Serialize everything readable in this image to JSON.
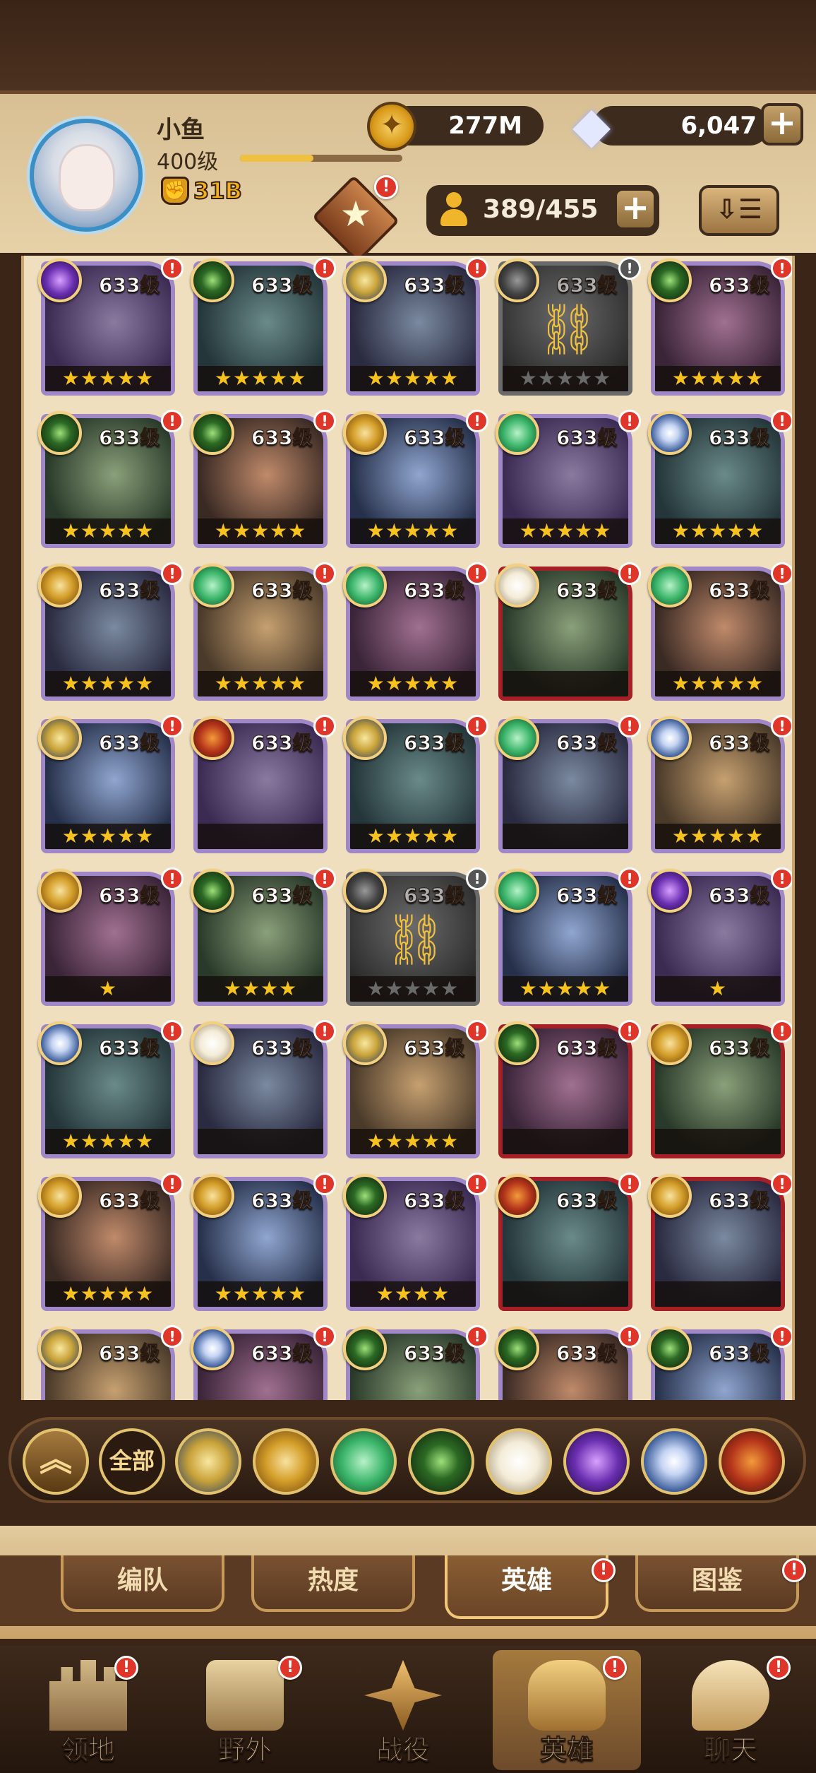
{
  "player": {
    "name": "小鱼",
    "level": "400级",
    "power": "31B",
    "xp_progress": 0.45,
    "avatar_icon": "portrait"
  },
  "currency": {
    "gold": "277M",
    "diamonds": "6,047",
    "gold_icon": "gold-coin-icon",
    "diamond_icon": "diamond-icon"
  },
  "hero_count": "389/455",
  "badge": "!",
  "heroes": [
    {
      "level": "633级",
      "stars": "★★★★★",
      "faction": "hypogean",
      "frame": "purple"
    },
    {
      "level": "633级",
      "stars": "★★★★★",
      "faction": "graveborn",
      "frame": "purple"
    },
    {
      "level": "633级",
      "stars": "★★★★★",
      "faction": "lightbearer",
      "frame": "purple"
    },
    {
      "level": "633级",
      "stars": "★★★★★",
      "faction": "dark",
      "frame": "gray",
      "locked": true
    },
    {
      "level": "633级",
      "stars": "★★★★★",
      "faction": "graveborn",
      "frame": "purple"
    },
    {
      "level": "633级",
      "stars": "★★★★★",
      "faction": "graveborn",
      "frame": "purple"
    },
    {
      "level": "633级",
      "stars": "★★★★★",
      "faction": "graveborn",
      "frame": "purple"
    },
    {
      "level": "633级",
      "stars": "★★★★★",
      "faction": "gear",
      "frame": "purple"
    },
    {
      "level": "633级",
      "stars": "★★★★★",
      "faction": "wilder",
      "frame": "purple"
    },
    {
      "level": "633级",
      "stars": "★★★★★",
      "faction": "dimensional",
      "frame": "purple"
    },
    {
      "level": "633级",
      "stars": "★★★★★",
      "faction": "gear",
      "frame": "purple"
    },
    {
      "level": "633级",
      "stars": "★★★★★",
      "faction": "wilder",
      "frame": "purple"
    },
    {
      "level": "633级",
      "stars": "★★★★★",
      "faction": "wilder",
      "frame": "purple"
    },
    {
      "level": "633级",
      "stars": "",
      "faction": "celestial",
      "frame": "red"
    },
    {
      "level": "633级",
      "stars": "★★★★★",
      "faction": "wilder",
      "frame": "purple"
    },
    {
      "level": "633级",
      "stars": "★★★★★",
      "faction": "lightbearer",
      "frame": "purple"
    },
    {
      "level": "633级",
      "stars": "",
      "faction": "mauler",
      "frame": "purple"
    },
    {
      "level": "633级",
      "stars": "★★★★★",
      "faction": "lightbearer",
      "frame": "purple"
    },
    {
      "level": "633级",
      "stars": "",
      "faction": "wilder",
      "frame": "purple"
    },
    {
      "level": "633级",
      "stars": "★★★★★",
      "faction": "dimensional",
      "frame": "purple"
    },
    {
      "level": "633级",
      "stars": "★",
      "faction": "gear",
      "frame": "purple"
    },
    {
      "level": "633级",
      "stars": "★★★★",
      "faction": "graveborn",
      "frame": "purple"
    },
    {
      "level": "633级",
      "stars": "★★★★★",
      "faction": "dark",
      "frame": "gray",
      "locked": true
    },
    {
      "level": "633级",
      "stars": "★★★★★",
      "faction": "wilder",
      "frame": "purple"
    },
    {
      "level": "633级",
      "stars": "★",
      "faction": "hypogean",
      "frame": "purple"
    },
    {
      "level": "633级",
      "stars": "★★★★★",
      "faction": "dimensional",
      "frame": "purple"
    },
    {
      "level": "633级",
      "stars": "",
      "faction": "celestial",
      "frame": "purple"
    },
    {
      "level": "633级",
      "stars": "★★★★★",
      "faction": "lightbearer",
      "frame": "purple"
    },
    {
      "level": "633级",
      "stars": "",
      "faction": "graveborn",
      "frame": "red"
    },
    {
      "level": "633级",
      "stars": "",
      "faction": "gear",
      "frame": "red"
    },
    {
      "level": "633级",
      "stars": "★★★★★",
      "faction": "gear",
      "frame": "purple"
    },
    {
      "level": "633级",
      "stars": "★★★★★",
      "faction": "gear",
      "frame": "purple"
    },
    {
      "level": "633级",
      "stars": "★★★★",
      "faction": "graveborn",
      "frame": "purple"
    },
    {
      "level": "633级",
      "stars": "",
      "faction": "mauler",
      "frame": "red"
    },
    {
      "level": "633级",
      "stars": "",
      "faction": "gear",
      "frame": "red"
    },
    {
      "level": "633级",
      "stars": "",
      "faction": "lightbearer",
      "frame": "purple"
    },
    {
      "level": "633级",
      "stars": "",
      "faction": "dimensional",
      "frame": "purple"
    },
    {
      "level": "633级",
      "stars": "",
      "faction": "graveborn",
      "frame": "purple"
    },
    {
      "level": "633级",
      "stars": "",
      "faction": "graveborn",
      "frame": "purple"
    },
    {
      "level": "633级",
      "stars": "",
      "faction": "graveborn",
      "frame": "purple"
    }
  ],
  "filters": {
    "all_label": "全部",
    "items": [
      "lightbearer",
      "gear",
      "wilder",
      "graveborn",
      "celestial",
      "hypogean",
      "dimensional",
      "mauler"
    ]
  },
  "subtabs": [
    "编队",
    "热度",
    "英雄",
    "图鉴"
  ],
  "nav": [
    "领地",
    "野外",
    "战役",
    "英雄",
    "聊天"
  ]
}
